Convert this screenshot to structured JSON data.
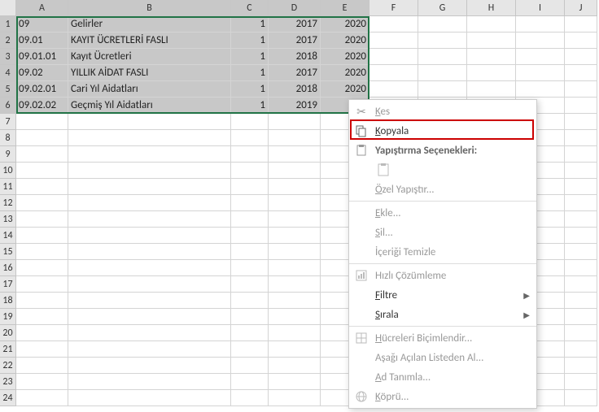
{
  "columns": [
    "A",
    "B",
    "C",
    "D",
    "E",
    "F",
    "G",
    "H",
    "I",
    "J"
  ],
  "rows": [
    "1",
    "2",
    "3",
    "4",
    "5",
    "6",
    "7",
    "8",
    "9",
    "10",
    "11",
    "12",
    "13",
    "14",
    "15",
    "16",
    "17",
    "18",
    "19",
    "20",
    "21",
    "22",
    "23",
    "24"
  ],
  "data": [
    {
      "a": "09",
      "b": "Gelirler",
      "c": "1",
      "d": "2017",
      "e": "2020"
    },
    {
      "a": "09.01",
      "b": "KAYIT ÜCRETLERİ FASLI",
      "c": "1",
      "d": "2017",
      "e": "2020"
    },
    {
      "a": "09.01.01",
      "b": "Kayıt Ücretleri",
      "c": "1",
      "d": "2018",
      "e": "2020"
    },
    {
      "a": "09.02",
      "b": "YILLIK AİDAT FASLI",
      "c": "1",
      "d": "2017",
      "e": "2020"
    },
    {
      "a": "09.02.01",
      "b": "Cari Yıl Aidatları",
      "c": "1",
      "d": "2018",
      "e": "2020"
    },
    {
      "a": "09.02.02",
      "b": "Geçmiş Yıl Aidatları",
      "c": "1",
      "d": "2019",
      "e": ""
    }
  ],
  "menu": {
    "cut": "Kes",
    "copy": "Kopyala",
    "paste_options": "Yapıştırma Seçenekleri:",
    "paste_special": "Özel Yapıştır...",
    "insert": "Ekle...",
    "delete": "Sil...",
    "clear": "İçeriği Temizle",
    "quick": "Hızlı Çözümleme",
    "filter": "Filtre",
    "sort": "Sırala",
    "format_cells": "Hücreleri Biçimlendir...",
    "dropdown": "Aşağı Açılan Listeden Al...",
    "define_name": "Ad Tanımla...",
    "hyperlink": "Köprü..."
  },
  "chart_data": null
}
